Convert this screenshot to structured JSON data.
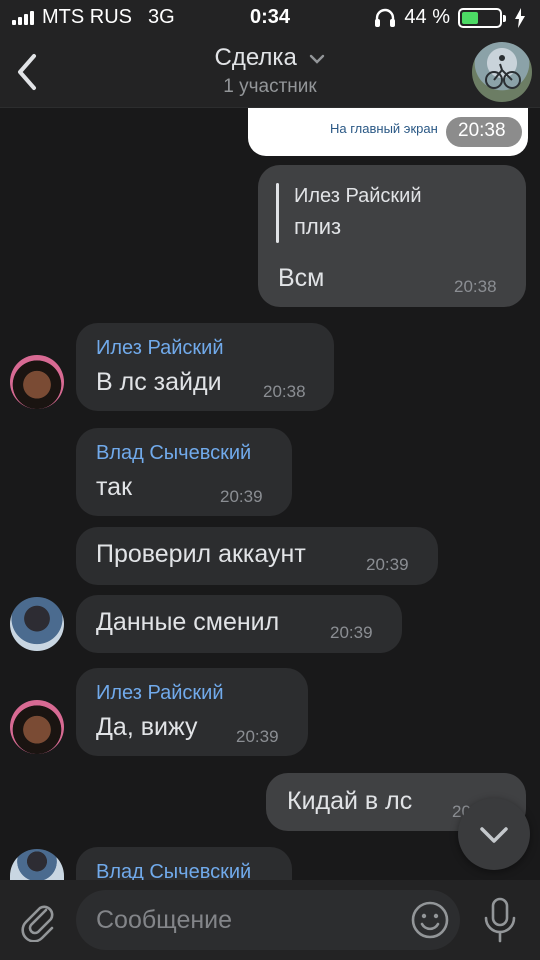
{
  "status_bar": {
    "carrier": "MTS RUS",
    "network": "3G",
    "time": "0:34",
    "battery_percent": "44 %",
    "battery_level": 0.44
  },
  "header": {
    "title": "Сделка",
    "subtitle": "1 участник",
    "back_icon": "chevron-left-icon",
    "dropdown_icon": "chevron-down-icon"
  },
  "messages": [
    {
      "kind": "out",
      "text": "На главный экран",
      "time": "20:38"
    },
    {
      "kind": "out",
      "reply_sender": "Илез Райский",
      "reply_text": "плиз",
      "text": "Всм",
      "time": "20:38"
    },
    {
      "kind": "in",
      "sender": "Илез Райский",
      "text": "В лс зайди",
      "time": "20:38"
    },
    {
      "kind": "in",
      "sender": "Влад Сычевский",
      "text": "так",
      "time": "20:39"
    },
    {
      "kind": "in",
      "text": "Проверил аккаунт",
      "time": "20:39"
    },
    {
      "kind": "in",
      "text": "Данные сменил",
      "time": "20:39"
    },
    {
      "kind": "in",
      "sender": "Илез Райский",
      "text": "Да, вижу",
      "time": "20:39"
    },
    {
      "kind": "out",
      "text": "Кидай в лс",
      "time": "20:39"
    },
    {
      "kind": "in",
      "sender": "Влад Сычевский"
    }
  ],
  "input": {
    "placeholder": "Сообщение",
    "attach_icon": "paperclip-icon",
    "emoji_icon": "smile-icon",
    "mic_icon": "microphone-icon"
  },
  "colors": {
    "background": "#19191a",
    "bar": "#232324",
    "incoming": "#2c2d2f",
    "outgoing": "#404143",
    "sender": "#71aaeb",
    "battery": "#4cd964"
  }
}
